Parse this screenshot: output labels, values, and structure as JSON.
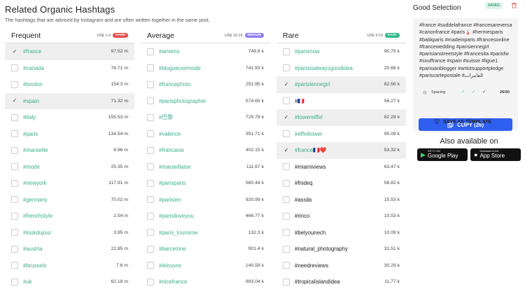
{
  "header": {
    "title": "Related Organic Hashtags",
    "subtitle": "The hashtags that are advised by Instagram and are often written together in the same post."
  },
  "columns": [
    {
      "name": "Frequent",
      "use": "USE 1-4",
      "badge": "HARD",
      "rows": [
        {
          "tag": "#france",
          "count": "97.52 m",
          "selected": true
        },
        {
          "tag": "#canada",
          "count": "76.71 m",
          "selected": false
        },
        {
          "tag": "#london",
          "count": "154.3 m",
          "selected": false
        },
        {
          "tag": "#spain",
          "count": "71.32 m",
          "selected": true
        },
        {
          "tag": "#italy",
          "count": "155.53 m",
          "selected": false
        },
        {
          "tag": "#paris",
          "count": "134.54 m",
          "selected": false
        },
        {
          "tag": "#marseille",
          "count": "8.96 m",
          "selected": false
        },
        {
          "tag": "#mode",
          "count": "25.35 m",
          "selected": false
        },
        {
          "tag": "#newyork",
          "count": "117.91 m",
          "selected": false
        },
        {
          "tag": "#germany",
          "count": "70.02 m",
          "selected": false
        },
        {
          "tag": "#frenchstyle",
          "count": "2.54 m",
          "selected": false
        },
        {
          "tag": "#lookdujour",
          "count": "3.95 m",
          "selected": false
        },
        {
          "tag": "#austria",
          "count": "22.85 m",
          "selected": false
        },
        {
          "tag": "#brussels",
          "count": "7.6 m",
          "selected": false
        },
        {
          "tag": "#uk",
          "count": "62.18 m",
          "selected": false
        }
      ]
    },
    {
      "name": "Average",
      "use": "USE 10-15",
      "badge": "MEDIUM",
      "rows": [
        {
          "tag": "#amiens",
          "count": "749.9 k",
          "selected": false
        },
        {
          "tag": "#blogueusemode",
          "count": "741.93 k",
          "selected": false
        },
        {
          "tag": "#francephoto",
          "count": "251.95 k",
          "selected": false
        },
        {
          "tag": "#parisphotographer",
          "count": "574.65 k",
          "selected": false
        },
        {
          "tag": "#巴黎",
          "count": "725.78 k",
          "selected": false
        },
        {
          "tag": "#valence",
          "count": "351.71 k",
          "selected": false
        },
        {
          "tag": "#francaise",
          "count": "402.15 k",
          "selected": false
        },
        {
          "tag": "#marseillaise",
          "count": "111.67 k",
          "selected": false
        },
        {
          "tag": "#pansparis",
          "count": "560.44 k",
          "selected": false
        },
        {
          "tag": "#parisien",
          "count": "920.99 k",
          "selected": false
        },
        {
          "tag": "#parisiloveyou",
          "count": "466.77 k",
          "selected": false
        },
        {
          "tag": "#paris_tourisme",
          "count": "132.3 k",
          "selected": false
        },
        {
          "tag": "#barcelone",
          "count": "901.4 k",
          "selected": false
        },
        {
          "tag": "#lelouvre",
          "count": "140.59 k",
          "selected": false
        },
        {
          "tag": "#nicefrance",
          "count": "993.04 k",
          "selected": false
        }
      ]
    },
    {
      "name": "Rare",
      "use": "USE 5-10",
      "badge": "EASY",
      "rows": [
        {
          "tag": "#parisnow",
          "count": "90.75 k",
          "selected": false,
          "dark": false
        },
        {
          "tag": "#parisisalwaysgoodidea",
          "count": "20.66 k",
          "selected": false,
          "dark": false
        },
        {
          "tag": "#parisiennegirl",
          "count": "82.56 k",
          "selected": true,
          "dark": false
        },
        {
          "tag": "#🇫🇷",
          "count": "56.27 k",
          "selected": false,
          "dark": true
        },
        {
          "tag": "#towereiffel",
          "count": "82.28 k",
          "selected": true,
          "dark": false
        },
        {
          "tag": "#effeiltower",
          "count": "95.09 k",
          "selected": false,
          "dark": false
        },
        {
          "tag": "#france🇫🇷❤️",
          "count": "53.32 k",
          "selected": true,
          "dark": false
        },
        {
          "tag": "#miamiviews",
          "count": "63.47 k",
          "selected": false,
          "dark": true
        },
        {
          "tag": "#fnideq",
          "count": "56.82 k",
          "selected": false,
          "dark": true
        },
        {
          "tag": "#assila",
          "count": "15.53 k",
          "selected": false,
          "dark": true
        },
        {
          "tag": "#rinco",
          "count": "10.53 k",
          "selected": false,
          "dark": true
        },
        {
          "tag": "#belyounech",
          "count": "10.09 k",
          "selected": false,
          "dark": true
        },
        {
          "tag": "#natural_photography",
          "count": "31.51 k",
          "selected": false,
          "dark": true
        },
        {
          "tag": "#needreviews",
          "count": "30.29 k",
          "selected": false,
          "dark": true
        },
        {
          "tag": "#tropicalislandidea",
          "count": "11.77 k",
          "selected": false,
          "dark": true
        }
      ]
    }
  ],
  "selection": {
    "title": "Good Selection",
    "saved_label": "SAVED",
    "text": "#france #suddelafrance #francesareversa #canonfrance #paris🗼 #hermesparis #batikparis #madeinparis #francesonline #francewedding #parisiennegirl #parisianstreetstyle #francesita #parisfw #souffrance #spain #suisse #ligue1 #parisianblogger #artistsupportpledge #pariscartepostale #العامرات",
    "spacing_label": "Spacing",
    "count": "26/30",
    "copy_label": "COPY (26)",
    "template_label": "SAVE AS TEMPLATE",
    "also_label": "Also available on",
    "google_small": "GET IT ON",
    "google_big": "Google Play",
    "apple_small": "Download on the",
    "apple_big": "App Store"
  }
}
